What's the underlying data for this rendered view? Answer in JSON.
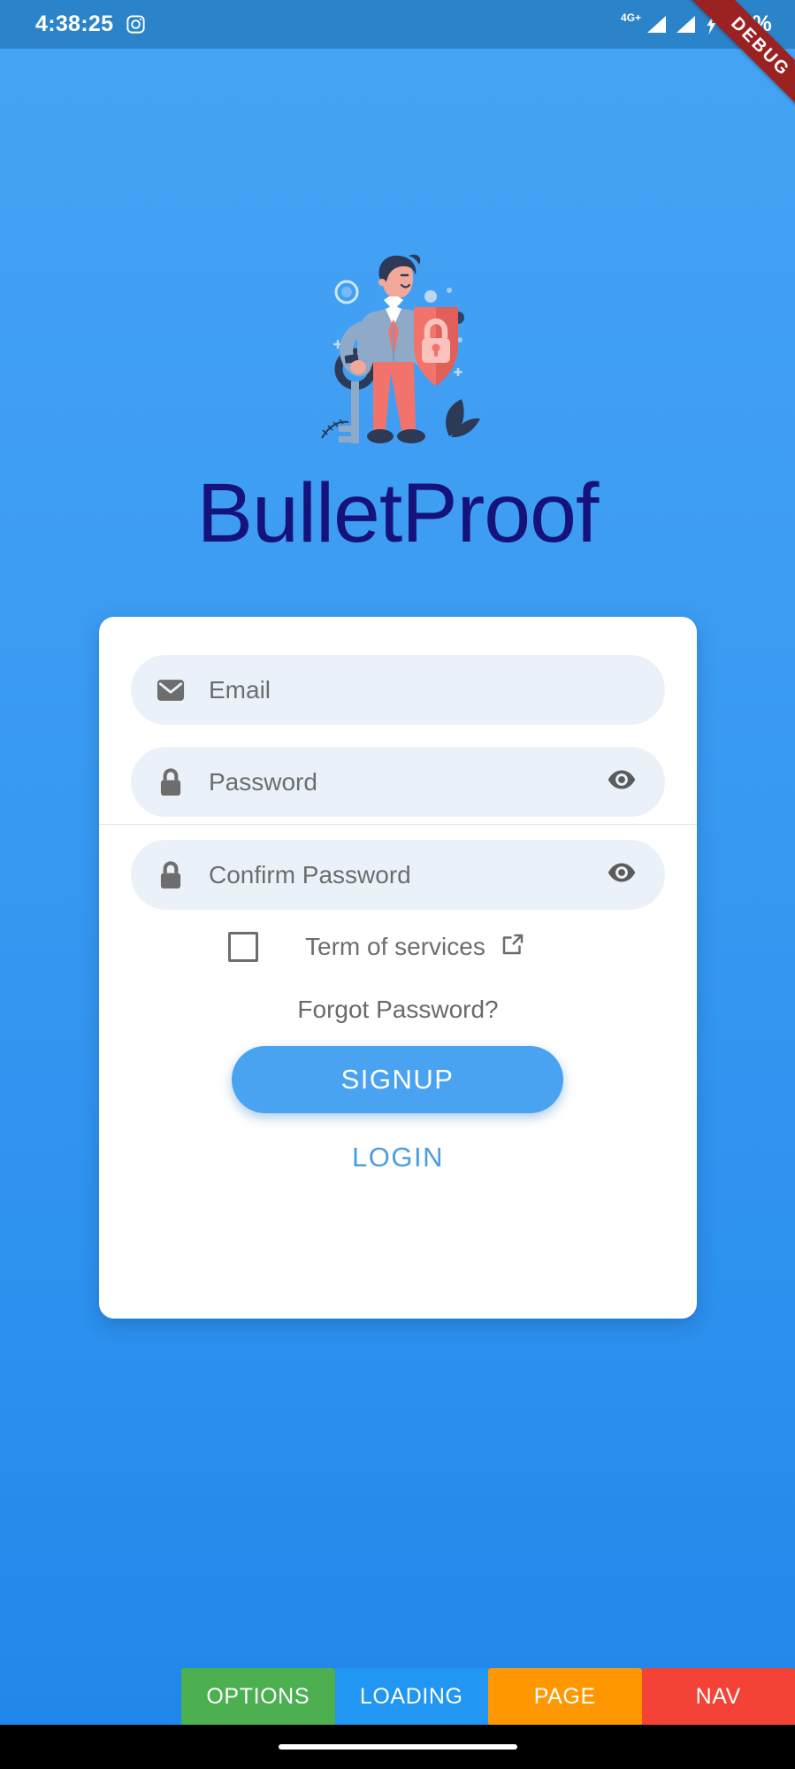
{
  "status_bar": {
    "time": "4:38:25",
    "notification_icon": "instagram-icon",
    "network_type": "4G+",
    "signal_icon": "signal-bars-icon",
    "charging_icon": "lightning-bolt-icon",
    "battery": "45%",
    "background_color": "#2b83c9"
  },
  "debug_banner": {
    "label": "DEBUG",
    "color": "#9c2222"
  },
  "background": {
    "gradient_top": "#46a4f5",
    "gradient_bottom": "#1f87ea"
  },
  "hero": {
    "illustration_name": "security-person-with-shield-and-key-illustration",
    "shield_color": "#f2736b",
    "lock_color": "#f7b3ad",
    "suit_color": "#8fa9c9",
    "pants_color": "#f2736b",
    "hair_color": "#2c3a57"
  },
  "app_title": {
    "text": "BulletProof",
    "color": "#15127c"
  },
  "form": {
    "fields": [
      {
        "name": "email",
        "icon": "envelope-icon",
        "placeholder": "Email",
        "value": "",
        "has_toggle": false
      },
      {
        "name": "password",
        "icon": "lock-icon",
        "placeholder": "Password",
        "value": "",
        "has_toggle": true,
        "toggle_icon": "eye-icon"
      },
      {
        "name": "confirm_password",
        "icon": "lock-icon",
        "placeholder": "Confirm Password",
        "value": "",
        "has_toggle": true,
        "toggle_icon": "eye-icon"
      }
    ],
    "terms": {
      "checked": false,
      "label": "Term of services",
      "external_link_icon": "external-link-icon"
    },
    "forgot_password": "Forgot Password?",
    "signup_button": "SIGNUP",
    "login_link": "LOGIN",
    "field_background": "#eaf1f8",
    "placeholder_color": "#6d6d6d",
    "accent_color": "#4aa3f0"
  },
  "bottom_bar": {
    "buttons": [
      {
        "label": "OPTIONS",
        "color": "#4caf50"
      },
      {
        "label": "LOADING",
        "color": "#2196f3"
      },
      {
        "label": "PAGE",
        "color": "#ff9800"
      },
      {
        "label": "NAV",
        "color": "#f44336"
      }
    ]
  },
  "gesture_nav": {
    "handle": "home-gesture-pill"
  }
}
